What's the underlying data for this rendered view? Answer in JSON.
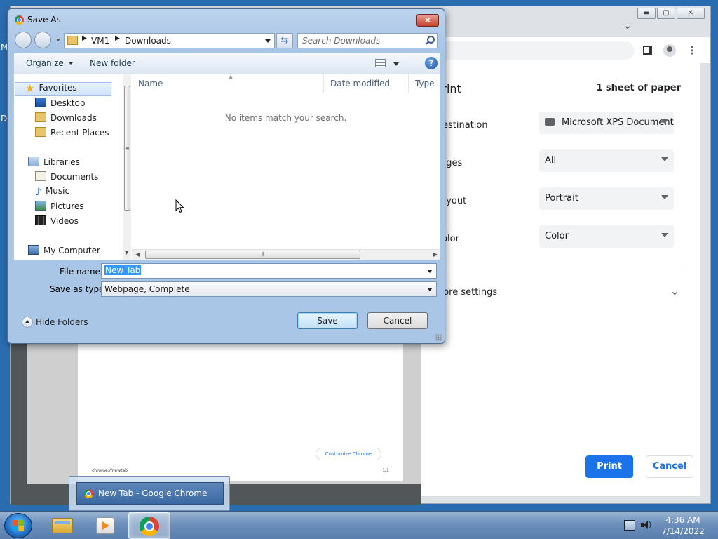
{
  "desktop": {
    "edge_letters": [
      "M",
      "D"
    ]
  },
  "chrome": {
    "win_controls": {
      "minimize": "▬",
      "maximize": "▢",
      "close": "✕"
    },
    "print_panel": {
      "title": "Print",
      "sheets": "1 sheet of paper",
      "rows": [
        {
          "label": "Destination",
          "value": "Microsoft XPS Document Writer"
        },
        {
          "label": "Pages",
          "value": "All"
        },
        {
          "label": "Layout",
          "value": "Portrait"
        },
        {
          "label": "Color",
          "value": "Color"
        }
      ],
      "more_settings": "More settings",
      "print_label": "Print",
      "cancel_label": "Cancel"
    },
    "preview": {
      "customize_chip": "Customize Chrome",
      "footer_left": "chrome://newtab",
      "footer_right": "1/1"
    }
  },
  "dialog": {
    "title": "Save As",
    "close_glyph": "✕",
    "breadcrumbs": [
      "VM1",
      "Downloads"
    ],
    "search_placeholder": "Search Downloads",
    "toolbar": {
      "organize": "Organize",
      "new_folder": "New folder",
      "help": "?"
    },
    "nav": {
      "favorites": "Favorites",
      "desktop": "Desktop",
      "downloads": "Downloads",
      "recent_places": "Recent Places",
      "libraries": "Libraries",
      "documents": "Documents",
      "music": "Music",
      "pictures": "Pictures",
      "videos": "Videos",
      "my_computer": "My Computer"
    },
    "columns": {
      "name": "Name",
      "date_modified": "Date modified",
      "type": "Type"
    },
    "empty_message": "No items match your search.",
    "file_name_label": "File name:",
    "file_name_value": "New Tab",
    "save_as_type_label": "Save as type:",
    "save_as_type_value": "Webpage, Complete",
    "hide_folders": "Hide Folders",
    "save_label": "Save",
    "cancel_label": "Cancel"
  },
  "taskbar": {
    "preview_title": "New Tab - Google Chrome",
    "clock_time": "4:36 AM",
    "clock_date": "7/14/2022"
  }
}
